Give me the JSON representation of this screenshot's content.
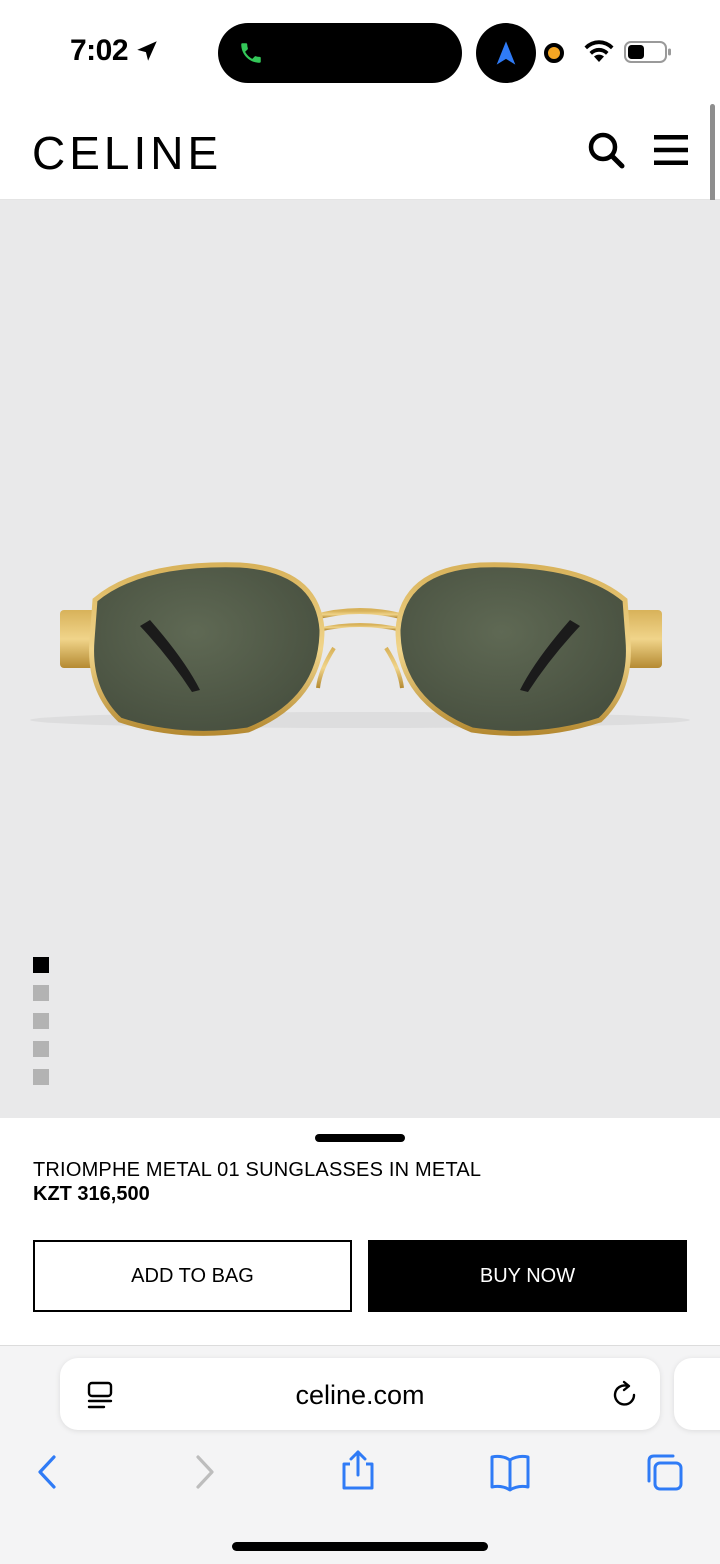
{
  "status_bar": {
    "time": "7:02",
    "icons": [
      "location-arrow-icon",
      "phone-call-icon",
      "navigation-icon",
      "wifi-icon",
      "battery-icon"
    ]
  },
  "header": {
    "logo": "CELINE",
    "icons": [
      "search-icon",
      "hamburger-menu-icon"
    ]
  },
  "gallery": {
    "image": "sunglasses-product-photo",
    "page_count": 5,
    "active_index": 0
  },
  "product": {
    "name": "TRIOMPHE METAL 01 SUNGLASSES IN METAL",
    "price": "KZT 316,500",
    "add_to_bag_label": "ADD TO BAG",
    "buy_now_label": "BUY NOW"
  },
  "browser": {
    "url": "celine.com",
    "toolbar_icons": [
      "back-icon",
      "forward-icon",
      "share-icon",
      "bookmarks-icon",
      "tabs-icon"
    ]
  },
  "colors": {
    "accent": "#000000",
    "image_background": "#e9e9ea",
    "browser_tint": "#2f7bf6"
  }
}
